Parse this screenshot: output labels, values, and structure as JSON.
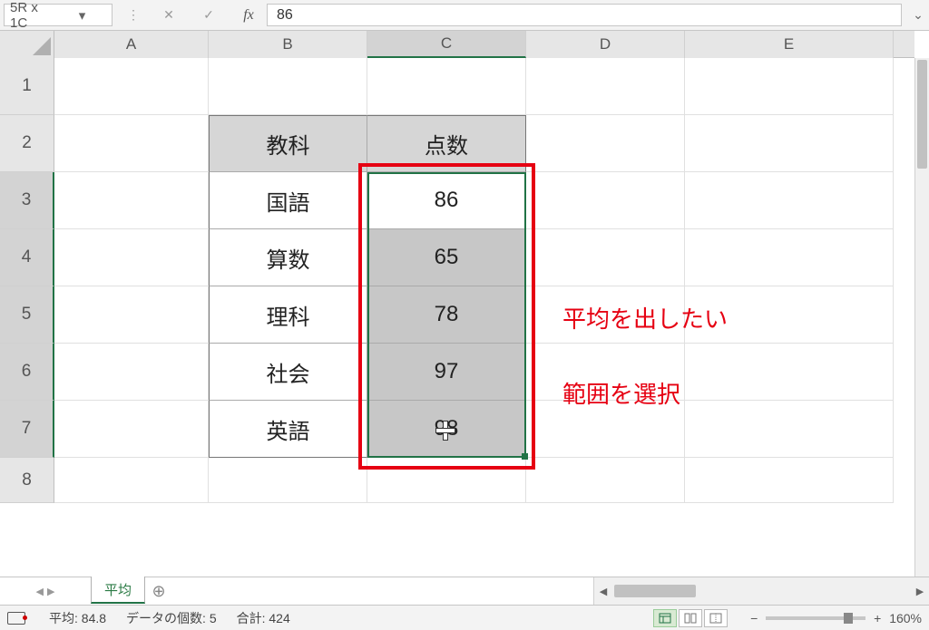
{
  "name_box": "5R x 1C",
  "formula_value": "86",
  "columns": [
    "A",
    "B",
    "C",
    "D",
    "E"
  ],
  "row_labels": [
    "1",
    "2",
    "3",
    "4",
    "5",
    "6",
    "7",
    "8"
  ],
  "table": {
    "header": {
      "subject": "教科",
      "score": "点数"
    },
    "rows": [
      {
        "subject": "国語",
        "score": "86"
      },
      {
        "subject": "算数",
        "score": "65"
      },
      {
        "subject": "理科",
        "score": "78"
      },
      {
        "subject": "社会",
        "score": "97"
      },
      {
        "subject": "英語",
        "score": "98"
      }
    ]
  },
  "annotation": {
    "line1": "平均を出したい",
    "line2": "範囲を選択"
  },
  "sheet_tab": "平均",
  "status": {
    "avg_label": "平均:",
    "avg_value": "84.8",
    "count_label": "データの個数:",
    "count_value": "5",
    "sum_label": "合計:",
    "sum_value": "424",
    "zoom": "160%"
  }
}
